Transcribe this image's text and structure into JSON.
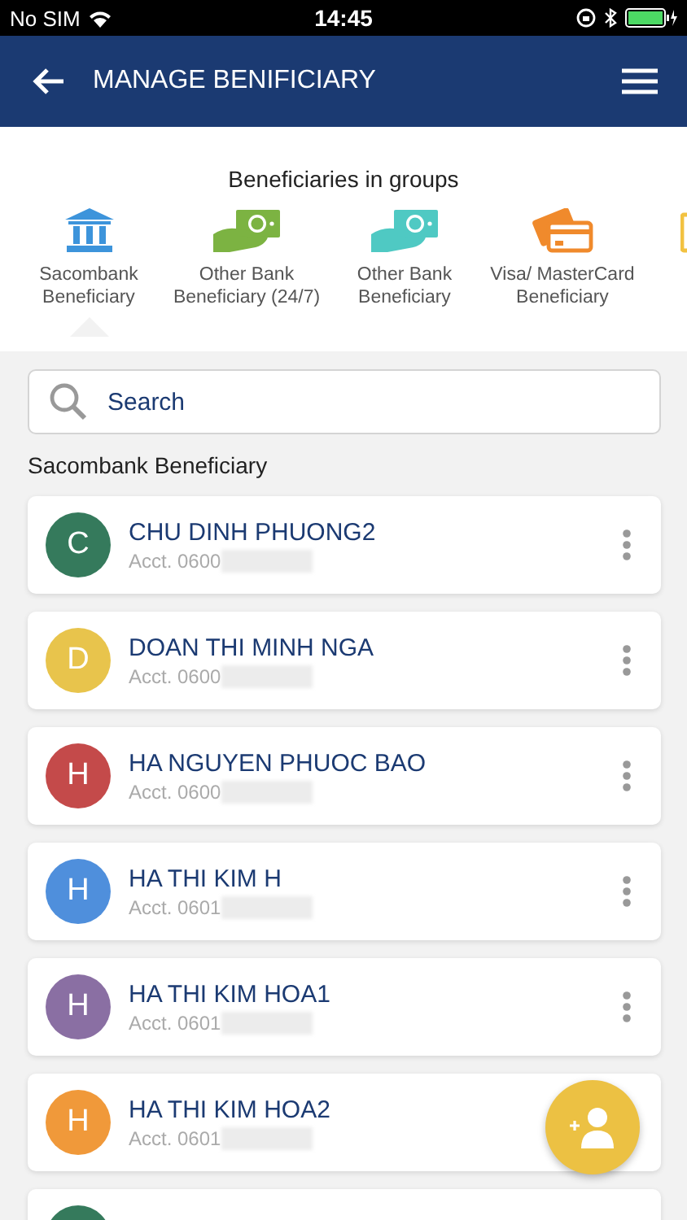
{
  "status_bar": {
    "carrier": "No SIM",
    "time": "14:45"
  },
  "header": {
    "title": "MANAGE BENIFICIARY"
  },
  "groups": {
    "title": "Beneficiaries in groups",
    "items": [
      {
        "label": "Sacombank Beneficiary",
        "kind": "bank",
        "selected": true
      },
      {
        "label": "Other Bank Beneficiary (24/7)",
        "kind": "cash",
        "color": "#7cb342",
        "selected": false
      },
      {
        "label": "Other Bank Beneficiary",
        "kind": "cash",
        "color": "#4fc9c3",
        "selected": false
      },
      {
        "label": "Visa/ MasterCard Beneficiary",
        "kind": "cards",
        "selected": false
      },
      {
        "kind": "partial",
        "selected": false
      }
    ]
  },
  "search": {
    "placeholder": "Search"
  },
  "section_title": "Sacombank Beneficiary",
  "beneficiaries": [
    {
      "initial": "C",
      "color": "#357a5c",
      "name": "CHU DINH PHUONG2",
      "account": "Acct. 0600",
      "more_options": true
    },
    {
      "initial": "D",
      "color": "#e8c44c",
      "name": "DOAN THI MINH NGA",
      "account": "Acct. 0600",
      "more_options": true
    },
    {
      "initial": "H",
      "color": "#c44a4a",
      "name": "HA NGUYEN PHUOC BAO",
      "account": "Acct. 0600",
      "more_options": true
    },
    {
      "initial": "H",
      "color": "#4f8fdc",
      "name": "HA THI KIM H",
      "account": "Acct. 0601",
      "more_options": true
    },
    {
      "initial": "H",
      "color": "#8a6fa3",
      "name": "HA THI KIM HOA1",
      "account": "Acct. 0601",
      "more_options": true
    },
    {
      "initial": "H",
      "color": "#f0993a",
      "name": "HA THI KIM HOA2",
      "account": "Acct. 0601",
      "more_options": false
    },
    {
      "color": "#357a5c"
    }
  ]
}
